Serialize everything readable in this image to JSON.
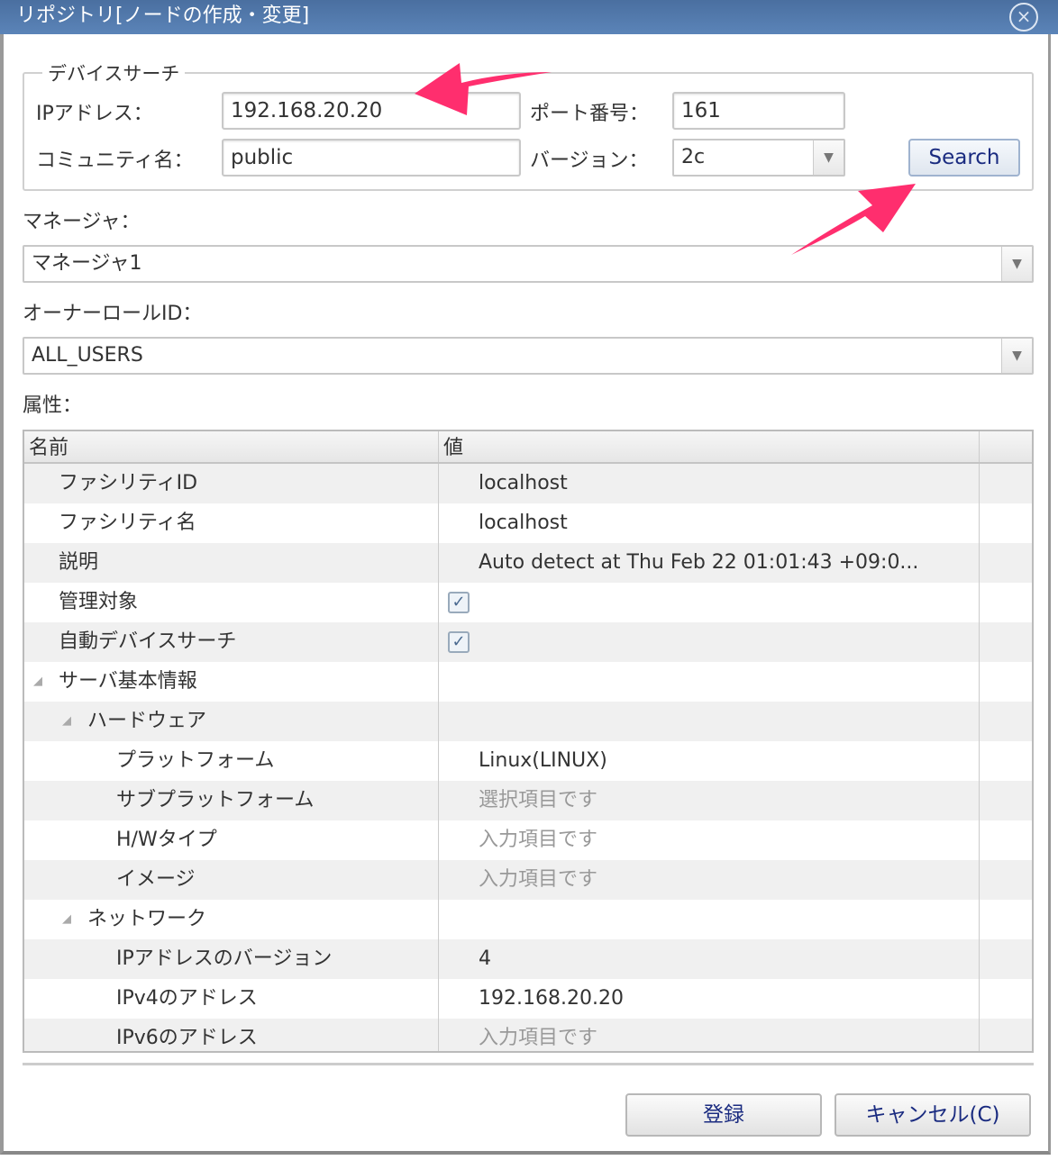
{
  "title": "リポジトリ[ノードの作成・変更]",
  "device_search": {
    "legend": "デバイスサーチ",
    "ip_label": "IPアドレス：",
    "ip_value": "192.168.20.20",
    "port_label": "ポート番号：",
    "port_value": "161",
    "community_label": "コミュニティ名：",
    "community_value": "public",
    "version_label": "バージョン：",
    "version_value": "2c",
    "search_label": "Search"
  },
  "manager": {
    "label": "マネージャ：",
    "value": "マネージャ1"
  },
  "owner": {
    "label": "オーナーロールID：",
    "value": "ALL_USERS"
  },
  "attributes": {
    "label": "属性：",
    "headers": [
      "名前",
      "値"
    ],
    "rows": [
      {
        "name": "ファシリティID",
        "value": "localhost",
        "level": 0
      },
      {
        "name": "ファシリティ名",
        "value": "localhost",
        "level": 0
      },
      {
        "name": "説明",
        "value": "Auto detect at Thu Feb 22 01:01:43 +09:0...",
        "level": 0
      },
      {
        "name": "管理対象",
        "checked": true,
        "level": 0
      },
      {
        "name": "自動デバイスサーチ",
        "checked": true,
        "level": 0
      },
      {
        "name": "サーバ基本情報",
        "value": "",
        "level": 0,
        "expanded": true
      },
      {
        "name": "ハードウェア",
        "value": "",
        "level": 1,
        "expanded": true
      },
      {
        "name": "プラットフォーム",
        "value": "Linux(LINUX)",
        "level": 2
      },
      {
        "name": "サブプラットフォーム",
        "placeholder": "選択項目です",
        "level": 2
      },
      {
        "name": "H/Wタイプ",
        "placeholder": "入力項目です",
        "level": 2
      },
      {
        "name": "イメージ",
        "placeholder": "入力項目です",
        "level": 2
      },
      {
        "name": "ネットワーク",
        "value": "",
        "level": 1,
        "expanded": true
      },
      {
        "name": "IPアドレスのバージョン",
        "value": "4",
        "level": 2
      },
      {
        "name": "IPv4のアドレス",
        "value": "192.168.20.20",
        "level": 2
      },
      {
        "name": "IPv6のアドレス",
        "placeholder": "入力項目です",
        "level": 2
      }
    ]
  },
  "buttons": {
    "register": "登録",
    "cancel": "キャンセル(C)"
  },
  "colors": {
    "titlebar": "#4a6fa0",
    "annotation_arrow": "#ff2e6e"
  }
}
